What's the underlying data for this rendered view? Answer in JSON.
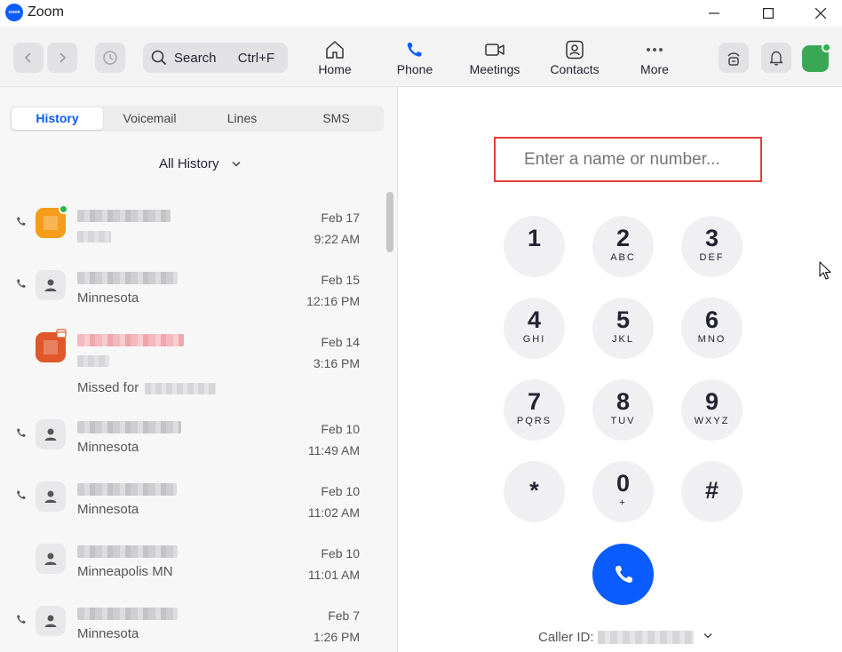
{
  "app": {
    "logo_text": "zoom",
    "title": "Zoom"
  },
  "toolbar": {
    "search_label": "Search",
    "search_shortcut": "Ctrl+F",
    "tabs": [
      {
        "label": "Home",
        "icon": "home-icon"
      },
      {
        "label": "Phone",
        "icon": "phone-icon",
        "active": true
      },
      {
        "label": "Meetings",
        "icon": "video-icon"
      },
      {
        "label": "Contacts",
        "icon": "contacts-icon"
      },
      {
        "label": "More",
        "icon": "more-icon"
      }
    ]
  },
  "phone": {
    "subtabs": [
      "History",
      "Voicemail",
      "Lines",
      "SMS"
    ],
    "active_subtab": "History",
    "filter": "All History",
    "history": [
      {
        "location": "",
        "date": "Feb 17",
        "time": "9:22 AM",
        "avatar": "orange",
        "presence": "online"
      },
      {
        "location": "Minnesota",
        "date": "Feb 15",
        "time": "12:16 PM",
        "avatar": "default"
      },
      {
        "location": "",
        "date": "Feb 14",
        "time": "3:16 PM",
        "avatar": "red",
        "missed_label": "Missed for"
      },
      {
        "location": "Minnesota",
        "date": "Feb 10",
        "time": "11:49 AM",
        "avatar": "default"
      },
      {
        "location": "Minnesota",
        "date": "Feb 10",
        "time": "11:02 AM",
        "avatar": "default"
      },
      {
        "location": "Minneapolis  MN",
        "date": "Feb 10",
        "time": "11:01 AM",
        "avatar": "default"
      },
      {
        "location": "Minnesota",
        "date": "Feb 7",
        "time": "1:26 PM",
        "avatar": "default"
      }
    ],
    "dialer": {
      "placeholder": "Enter a name or number...",
      "keys": [
        {
          "digit": "1",
          "letters": ""
        },
        {
          "digit": "2",
          "letters": "ABC"
        },
        {
          "digit": "3",
          "letters": "DEF"
        },
        {
          "digit": "4",
          "letters": "GHI"
        },
        {
          "digit": "5",
          "letters": "JKL"
        },
        {
          "digit": "6",
          "letters": "MNO"
        },
        {
          "digit": "7",
          "letters": "PQRS"
        },
        {
          "digit": "8",
          "letters": "TUV"
        },
        {
          "digit": "9",
          "letters": "WXYZ"
        },
        {
          "digit": "*",
          "letters": ""
        },
        {
          "digit": "0",
          "letters": "+"
        },
        {
          "digit": "#",
          "letters": ""
        }
      ],
      "caller_id_label": "Caller ID:"
    }
  },
  "colors": {
    "accent": "#0b5cff",
    "input_border": "#e03d3d",
    "presence": "#2bb44a"
  }
}
